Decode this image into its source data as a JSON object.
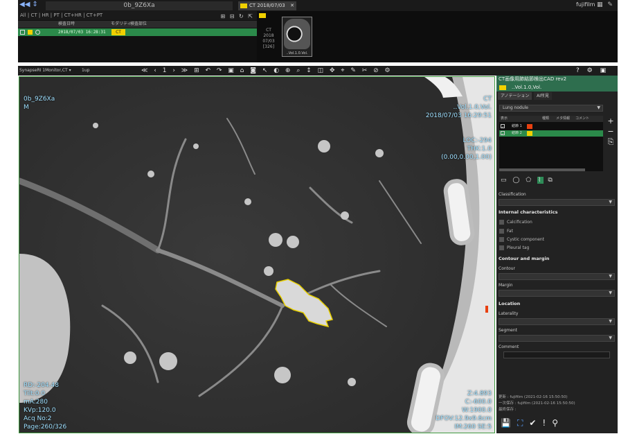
{
  "topbar": {
    "nav_glyph": "◀◀ ⇕",
    "patient_id": "0b_9Z6Xa",
    "study_tab": "CT 2018/07/03",
    "study_tab_close": "✕",
    "user": "fujifilm",
    "icons": "▦ ✎"
  },
  "study_list": {
    "filters": "All  |  CT  |  HR  |  PT  |  CT+HR  |  CT+PT",
    "filter_icons": "⊞ ⊟ ↻ ⇱",
    "headers": [
      "検査日時",
      "モダリティ",
      "検査部位"
    ],
    "row": {
      "datetime": "2018/07/03 16:28:31",
      "modality": "CT"
    }
  },
  "thumbnail": {
    "series_info": [
      "CT",
      "2018",
      "07/03",
      "[326]"
    ],
    "label": "..Vol.1.0.Vol."
  },
  "viewer_toolbar": {
    "layout": "SynapseRI 1Monitor,CT",
    "grid": "1up",
    "page": "1",
    "tools": "≪ ‹ 1 › ≫ ⊞ ↶ ↷ ▣ ⌂ ◙ ↖ ◐ ⊕ ⌕ ↕ ◫ ✥ ⌖ ✎ ✂ ⊘ ⚙",
    "right_icons": "? ⚙ ▣ ✕"
  },
  "viewer": {
    "top_left": [
      "0b_9Z6Xa",
      "",
      "",
      "M"
    ],
    "top_right": [
      "CT",
      "..Vol.1.0,Vol.",
      "2018/07/03 16:29:51",
      "",
      "",
      "LOC:-294",
      "THK:1.0",
      "(0.00,0.00,1.00)"
    ],
    "bottom_left": [
      "RD:-204.48",
      "Tilt:0.0",
      "mA:280",
      "KVp:120.0",
      "Acq No:2",
      "Page:260/326"
    ],
    "bottom_right": [
      "Z:4.893",
      "C:-600.0",
      "W:1900.0",
      "DFOV:12.9x9.6cm",
      "IM:260 SE:5"
    ]
  },
  "cad": {
    "title": "CT画像用肺結節検出CAD rev2",
    "series": "..Vol.1.0,Vol.",
    "tab_annotation": "アノテーション",
    "tab_ai": "AI所見",
    "nodule_type": "Lung nodule",
    "table_headers": [
      "表示",
      "",
      "種類",
      "メタ情報",
      "コメント"
    ],
    "nodules": [
      {
        "label": "結節 1",
        "color": "#e84010"
      },
      {
        "label": "結節 2",
        "color": "#f0d000"
      }
    ],
    "side_buttons": [
      "+",
      "−",
      "⎘"
    ],
    "shape_tools": [
      "▭",
      "◯",
      "⬠",
      "⌇",
      "⧉"
    ],
    "classification_label": "Classification",
    "internal_label": "Internal characteristics",
    "internal_items": [
      "Calcification",
      "Fat",
      "Cystic component",
      "Pleural tag"
    ],
    "contour_margin_label": "Contour and margin",
    "contour_label": "Contour",
    "margin_label": "Margin",
    "location_label": "Location",
    "laterality_label": "Laterality",
    "segment_label": "Segment",
    "comment_label": "Comment",
    "updated": "更新 : fujifilm (2021-02-16 15:50:50)",
    "first_saved": "一次保存 : fujifilm (2021-02-16 15:50:50)",
    "final_saved": "最終保存 :",
    "bottom_icons": [
      "💾",
      "⛶",
      "✔",
      "!",
      "⚲"
    ]
  }
}
